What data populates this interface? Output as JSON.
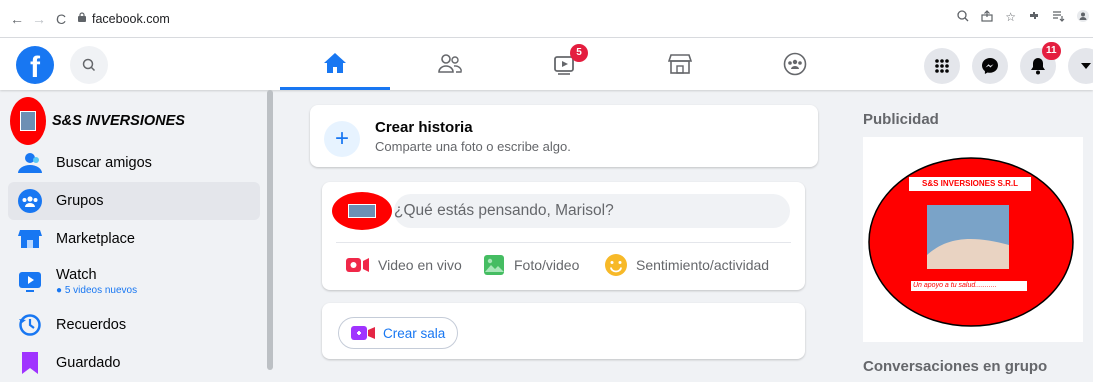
{
  "browser": {
    "url": "facebook.com"
  },
  "header": {
    "logo_letter": "f",
    "watch_badge": "5",
    "notifications_badge": "11",
    "active_tab": "home"
  },
  "sidebar": {
    "items": [
      {
        "label": "S&S INVERSIONES",
        "icon": "profile-avatar"
      },
      {
        "label": "Buscar amigos",
        "icon": "friends-icon"
      },
      {
        "label": "Grupos",
        "icon": "groups-icon"
      },
      {
        "label": "Marketplace",
        "icon": "marketplace-icon"
      },
      {
        "label": "Watch",
        "sub": "5 videos nuevos",
        "icon": "watch-icon"
      },
      {
        "label": "Recuerdos",
        "icon": "memories-icon"
      },
      {
        "label": "Guardado",
        "icon": "saved-icon"
      }
    ]
  },
  "story": {
    "title": "Crear historia",
    "subtitle": "Comparte una foto o escribe algo."
  },
  "composer": {
    "placeholder": "¿Qué estás pensando, Marisol?",
    "actions": [
      {
        "label": "Video en vivo",
        "color": "#f02849"
      },
      {
        "label": "Foto/video",
        "color": "#45bd62"
      },
      {
        "label": "Sentimiento/actividad",
        "color": "#f7b928"
      }
    ]
  },
  "room": {
    "label": "Crear sala"
  },
  "right": {
    "ads_title": "Publicidad",
    "ad": {
      "brand": "S&S INVERSIONES S.R.L",
      "tagline": "Un apoyo a tu salud..........."
    },
    "conversations_title": "Conversaciones en grupo"
  },
  "colors": {
    "brand_blue": "#1877f2",
    "ad_red": "#ff0000",
    "badge_red": "#e41e3f"
  }
}
